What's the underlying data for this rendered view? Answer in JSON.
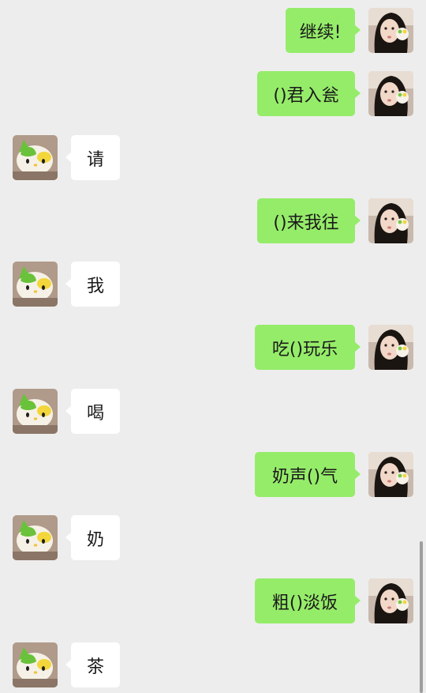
{
  "messages": [
    {
      "direction": "out",
      "text": "继续!"
    },
    {
      "direction": "out",
      "text": "()君入瓮"
    },
    {
      "direction": "in",
      "text": "请"
    },
    {
      "direction": "out",
      "text": "()来我往"
    },
    {
      "direction": "in",
      "text": "我"
    },
    {
      "direction": "out",
      "text": "吃()玩乐"
    },
    {
      "direction": "in",
      "text": "喝"
    },
    {
      "direction": "out",
      "text": "奶声()气"
    },
    {
      "direction": "in",
      "text": "奶"
    },
    {
      "direction": "out",
      "text": "粗()淡饭"
    },
    {
      "direction": "in",
      "text": "茶"
    }
  ],
  "colors": {
    "background": "#ededed",
    "outgoing_bubble": "#95ec69",
    "incoming_bubble": "#ffffff"
  },
  "icons": {
    "outgoing_avatar": "girl-photo-avatar",
    "incoming_avatar": "hello-kitty-avatar"
  }
}
